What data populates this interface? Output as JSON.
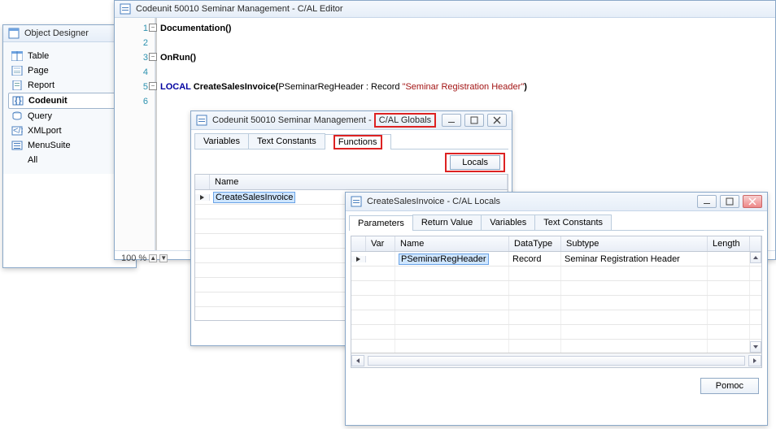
{
  "objectDesigner": {
    "title": "Object Designer",
    "items": [
      {
        "label": "Table",
        "icon": "table"
      },
      {
        "label": "Page",
        "icon": "page"
      },
      {
        "label": "Report",
        "icon": "report"
      },
      {
        "label": "Codeunit",
        "icon": "codeunit",
        "selected": true
      },
      {
        "label": "Query",
        "icon": "query"
      },
      {
        "label": "XMLport",
        "icon": "xmlport"
      },
      {
        "label": "MenuSuite",
        "icon": "menusuite"
      },
      {
        "label": "All",
        "icon": "all"
      }
    ]
  },
  "editor": {
    "title": "Codeunit 50010 Seminar Management - C/AL Editor",
    "zoom": "100 %",
    "lines": [
      {
        "n": 1,
        "fold": true,
        "segments": [
          {
            "t": "Documentation",
            "c": "id"
          },
          {
            "t": "()",
            "c": "paren"
          }
        ]
      },
      {
        "n": 2,
        "segments": []
      },
      {
        "n": 3,
        "fold": true,
        "segments": [
          {
            "t": "OnRun",
            "c": "id"
          },
          {
            "t": "()",
            "c": "paren"
          }
        ]
      },
      {
        "n": 4,
        "segments": []
      },
      {
        "n": 5,
        "fold": true,
        "segments": [
          {
            "t": "LOCAL ",
            "c": "kw"
          },
          {
            "t": "CreateSalesInvoice",
            "c": "id"
          },
          {
            "t": "(",
            "c": "paren"
          },
          {
            "t": "PSeminarRegHeader : Record ",
            "c": "txt"
          },
          {
            "t": "\"Seminar Registration Header\"",
            "c": "str"
          },
          {
            "t": ")",
            "c": "paren"
          }
        ]
      },
      {
        "n": 6,
        "segments": []
      }
    ]
  },
  "globals": {
    "title_prefix": "Codeunit 50010 Seminar Management -",
    "title_suffix": "C/AL Globals",
    "tabs": [
      "Variables",
      "Text Constants",
      "Functions"
    ],
    "active_tab": 2,
    "locals_button": "Locals",
    "columns": [
      "Name"
    ],
    "rows": [
      "CreateSalesInvoice"
    ]
  },
  "locals": {
    "title": "CreateSalesInvoice - C/AL Locals",
    "tabs": [
      "Parameters",
      "Return Value",
      "Variables",
      "Text Constants"
    ],
    "active_tab": 0,
    "columns": [
      "Var",
      "Name",
      "DataType",
      "Subtype",
      "Length"
    ],
    "rows": [
      {
        "var": "",
        "name": "PSeminarRegHeader",
        "datatype": "Record",
        "subtype": "Seminar Registration Header",
        "length": ""
      }
    ],
    "help_button": "Pomoc"
  }
}
